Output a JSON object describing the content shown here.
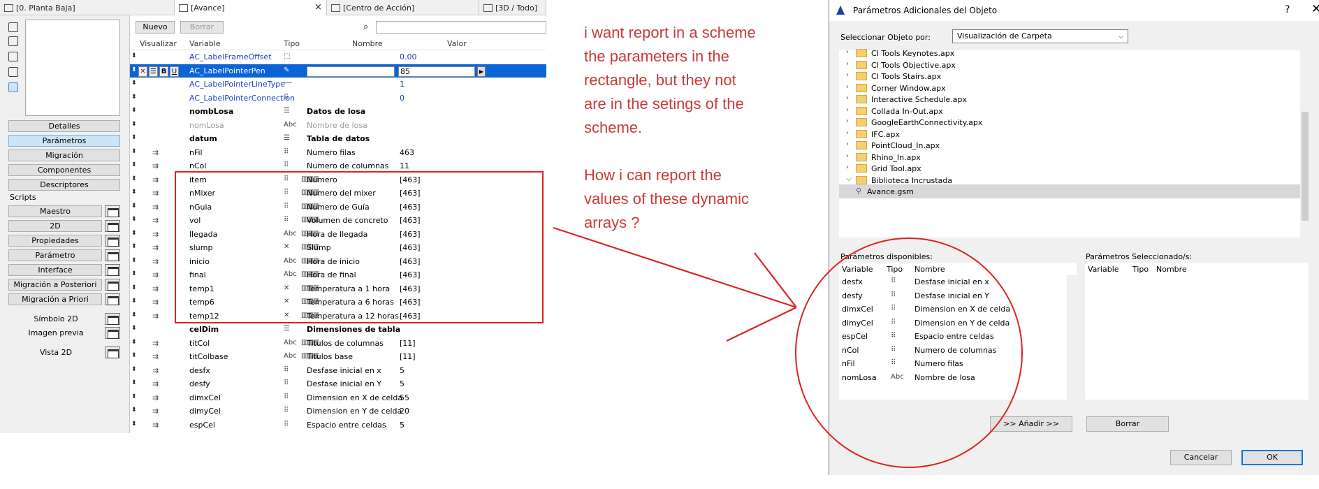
{
  "tabs": [
    {
      "label": "[0. Planta Baja]"
    },
    {
      "label": "[Avance]"
    },
    {
      "label": "[Centro de Acción]"
    },
    {
      "label": "[3D / Todo]"
    }
  ],
  "tab_close": "×",
  "toolbar": {
    "nuevo": "Nuevo",
    "borrar": "Borrar"
  },
  "sidebar": {
    "buttons": [
      "Detalles",
      "Parámetros",
      "Migración",
      "Componentes",
      "Descriptores"
    ],
    "scripts_label": "Scripts",
    "scripts": [
      "Maestro",
      "2D",
      "Propiedades",
      "Parámetro",
      "Interface",
      "Migración a Posteriori",
      "Migración a Priori"
    ],
    "extras": [
      "Símbolo 2D",
      "Imagen previa",
      "Vista 2D"
    ]
  },
  "grid": {
    "headers": {
      "visualizar": "Visualizar",
      "variable": "Variable",
      "tipo": "Tipo",
      "nombre": "Nombre",
      "valor": "Valor"
    },
    "rows": [
      {
        "var": "AC_LabelFrameOffset",
        "tipo": "⬚",
        "nombre": "",
        "valor": "0.00",
        "cls": "blue",
        "vis": "",
        "arr": ""
      },
      {
        "var": "AC_LabelPointerPen",
        "tipo": "✎",
        "nombre": "",
        "valor": "85",
        "cls": "sel",
        "vis": "",
        "arr": ""
      },
      {
        "var": "AC_LabelPointerLineType",
        "tipo": "╌╌",
        "nombre": "",
        "valor": "1",
        "cls": "blue",
        "vis": "",
        "arr": ""
      },
      {
        "var": "AC_LabelPointerConnection",
        "tipo": "⠿",
        "nombre": "",
        "valor": "0",
        "cls": "blue",
        "vis": "",
        "arr": ""
      },
      {
        "var": "nombLosa",
        "tipo": "☰",
        "nombre": "Datos de losa",
        "valor": "",
        "cls": "bold",
        "vis": "",
        "arr": ""
      },
      {
        "var": "nomLosa",
        "tipo": "Abc",
        "nombre": "Nombre de losa",
        "valor": "",
        "cls": "grey",
        "vis": "",
        "arr": ""
      },
      {
        "var": "datum",
        "tipo": "☰",
        "nombre": "Tabla de datos",
        "valor": "",
        "cls": "bold",
        "vis": "",
        "arr": ""
      },
      {
        "var": "nFil",
        "tipo": "⠿",
        "nombre": "Numero filas",
        "valor": "463",
        "cls": "",
        "vis": "⇉",
        "arr": ""
      },
      {
        "var": "nCol",
        "tipo": "⠿",
        "nombre": "Numero de columnas",
        "valor": "11",
        "cls": "",
        "vis": "⇉",
        "arr": ""
      },
      {
        "var": "item",
        "tipo": "⠿",
        "nombre": "Numero",
        "valor": "[463]",
        "cls": "",
        "vis": "⇉",
        "arr": "▥▥▥"
      },
      {
        "var": "nMixer",
        "tipo": "⠿",
        "nombre": "Numero del mixer",
        "valor": "[463]",
        "cls": "",
        "vis": "⇉",
        "arr": "▥▥▥"
      },
      {
        "var": "nGuia",
        "tipo": "⠿",
        "nombre": "Numero de Guía",
        "valor": "[463]",
        "cls": "",
        "vis": "⇉",
        "arr": "▥▥▥"
      },
      {
        "var": "vol",
        "tipo": "⠿",
        "nombre": "Volumen de concreto",
        "valor": "[463]",
        "cls": "",
        "vis": "⇉",
        "arr": "▥▥▥"
      },
      {
        "var": "llegada",
        "tipo": "Abc",
        "nombre": "Hora de llegada",
        "valor": "[463]",
        "cls": "",
        "vis": "⇉",
        "arr": "▥▥▥"
      },
      {
        "var": "slump",
        "tipo": "✕",
        "nombre": "Slump",
        "valor": "[463]",
        "cls": "",
        "vis": "⇉",
        "arr": "▥▥▥"
      },
      {
        "var": "inicio",
        "tipo": "Abc",
        "nombre": "Hora de inicio",
        "valor": "[463]",
        "cls": "",
        "vis": "⇉",
        "arr": "▥▥▥"
      },
      {
        "var": "final",
        "tipo": "Abc",
        "nombre": "Hora de final",
        "valor": "[463]",
        "cls": "",
        "vis": "⇉",
        "arr": "▥▥▥"
      },
      {
        "var": "temp1",
        "tipo": "✕",
        "nombre": "Temperatura a 1 hora",
        "valor": "[463]",
        "cls": "",
        "vis": "⇉",
        "arr": "▥▥▥"
      },
      {
        "var": "temp6",
        "tipo": "✕",
        "nombre": "Temperatura a 6 horas",
        "valor": "[463]",
        "cls": "",
        "vis": "⇉",
        "arr": "▥▥▥"
      },
      {
        "var": "temp12",
        "tipo": "✕",
        "nombre": "Temperatura a 12 horas",
        "valor": "[463]",
        "cls": "",
        "vis": "⇉",
        "arr": "▥▥▥"
      },
      {
        "var": "celDim",
        "tipo": "☰",
        "nombre": "Dimensiones de tabla",
        "valor": "",
        "cls": "bold",
        "vis": "",
        "arr": ""
      },
      {
        "var": "titCol",
        "tipo": "Abc",
        "nombre": "Titulos de columnas",
        "valor": "[11]",
        "cls": "",
        "vis": "⇉",
        "arr": "▥▥▥"
      },
      {
        "var": "titColbase",
        "tipo": "Abc",
        "nombre": "Titulos base",
        "valor": "[11]",
        "cls": "",
        "vis": "⇉",
        "arr": "▥▥▥"
      },
      {
        "var": "desfx",
        "tipo": "⠿",
        "nombre": "Desfase inicial en x",
        "valor": "5",
        "cls": "",
        "vis": "⇉",
        "arr": ""
      },
      {
        "var": "desfy",
        "tipo": "⠿",
        "nombre": "Desfase inicial en Y",
        "valor": "5",
        "cls": "",
        "vis": "⇉",
        "arr": ""
      },
      {
        "var": "dimxCel",
        "tipo": "⠿",
        "nombre": "Dimension en X de celda",
        "valor": "55",
        "cls": "",
        "vis": "⇉",
        "arr": ""
      },
      {
        "var": "dimyCel",
        "tipo": "⠿",
        "nombre": "Dimension en Y de celda",
        "valor": "20",
        "cls": "",
        "vis": "⇉",
        "arr": ""
      },
      {
        "var": "espCel",
        "tipo": "⠿",
        "nombre": "Espacio entre celdas",
        "valor": "5",
        "cls": "",
        "vis": "⇉",
        "arr": ""
      }
    ]
  },
  "annotations": {
    "note1": [
      "i want report in a scheme",
      "the parameters in the",
      "rectangle, but they not",
      "are in the setings of the",
      "scheme."
    ],
    "note2": [
      "How i can report the",
      "values of these dynamic",
      "arrays ?"
    ]
  },
  "dialog": {
    "title": "Parámetros Adicionales del Objeto",
    "help": "?",
    "close": "✕",
    "select_label": "Seleccionar Objeto por:",
    "select_value": "Visualización de Carpeta",
    "tree": [
      "CI Tools Keynotes.apx",
      "CI Tools Objective.apx",
      "CI Tools Stairs.apx",
      "Corner Window.apx",
      "Interactive Schedule.apx",
      "Collada In-Out.apx",
      "GoogleEarthConnectivity.apx",
      "IFC.apx",
      "PointCloud_In.apx",
      "Rhino_In.apx",
      "Grid Tool.apx",
      "Biblioteca Incrustada",
      "Avance.gsm"
    ],
    "avail_label": "Parámetros disponibles:",
    "selected_label": "Parámetros Seleccionado/s:",
    "cols": {
      "variable": "Variable",
      "tipo": "Tipo",
      "nombre": "Nombre"
    },
    "avail_rows": [
      {
        "var": "desfx",
        "tipo": "⠿",
        "nombre": "Desfase inicial en x"
      },
      {
        "var": "desfy",
        "tipo": "⠿",
        "nombre": "Desfase inicial en Y"
      },
      {
        "var": "dimxCel",
        "tipo": "⠿",
        "nombre": "Dimension en X de celda"
      },
      {
        "var": "dimyCel",
        "tipo": "⠿",
        "nombre": "Dimension en Y de celda"
      },
      {
        "var": "espCel",
        "tipo": "⠿",
        "nombre": "Espacio entre celdas"
      },
      {
        "var": "nCol",
        "tipo": "⠿",
        "nombre": "Numero de columnas"
      },
      {
        "var": "nFil",
        "tipo": "⠿",
        "nombre": "Numero filas"
      },
      {
        "var": "nomLosa",
        "tipo": "Abc",
        "nombre": "Nombre de losa"
      }
    ],
    "add_button": ">> Añadir >>",
    "delete_button": "Borrar",
    "cancel_button": "Cancelar",
    "ok_button": "OK"
  },
  "colors": {
    "accent": "#0a64d8",
    "annotation": "#c83a3a",
    "folder": "#f5cf72"
  }
}
